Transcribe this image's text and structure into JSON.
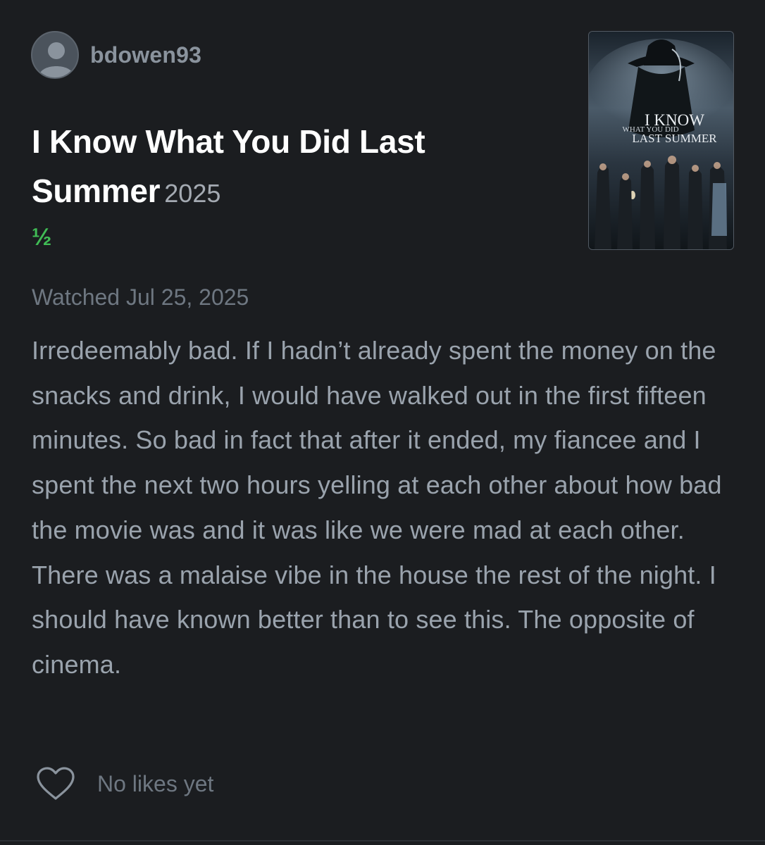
{
  "review": {
    "username": "bdowen93",
    "film_title": "I Know What You Did Last Summer",
    "film_year": "2025",
    "rating": "½",
    "watched": "Watched Jul 25, 2025",
    "text": "Irredeemably bad. If I hadn’t already spent the money on the snacks and drink, I would have walked out in the first fifteen minutes. So bad in fact that after it ended, my fiancee and I spent the next two hours yelling at each other about how bad the movie was and it was like we were mad at each other. There was a malaise vibe in the house the rest of the night. I should have known better than to see this. The opposite of cinema.",
    "likes_label": "No likes yet"
  },
  "poster": {
    "title_line1": "I KNOW",
    "title_line2": "WHAT YOU DID",
    "title_line3": "LAST SUMMER"
  },
  "icons": {
    "avatar": "user-avatar-icon",
    "like": "heart-outline-icon"
  },
  "colors": {
    "background": "#1b1d20",
    "rating_green": "#40bc55",
    "title_white": "#ffffff",
    "muted_text": "#9aa3ad"
  }
}
